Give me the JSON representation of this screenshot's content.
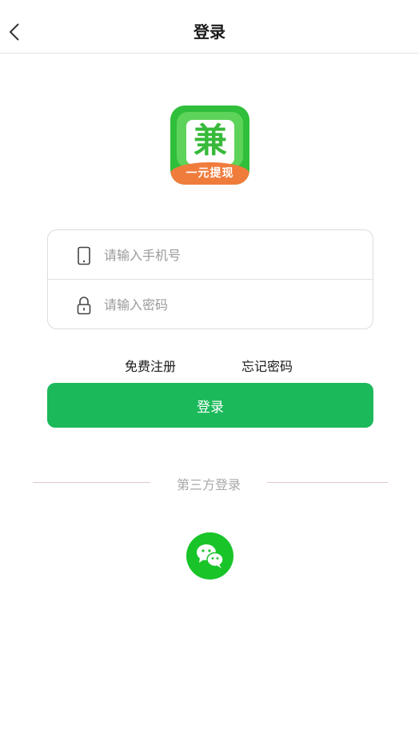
{
  "navbar": {
    "title": "登录",
    "back_icon": "chevron-left-icon"
  },
  "logo": {
    "char": "兼",
    "band_text": "一元提现",
    "colors": {
      "green": "#2fbf3a",
      "orange": "#f07c3c"
    }
  },
  "form": {
    "phone": {
      "placeholder": "请输入手机号",
      "value": "",
      "icon": "phone-icon"
    },
    "password": {
      "placeholder": "请输入密码",
      "value": "",
      "icon": "lock-icon"
    }
  },
  "links": {
    "register": "免费注册",
    "forgot": "忘记密码"
  },
  "login_button": {
    "label": "登录",
    "color": "#1bb95a"
  },
  "third_party": {
    "label": "第三方登录",
    "wechat": {
      "icon": "wechat-icon",
      "color": "#19c429"
    }
  }
}
